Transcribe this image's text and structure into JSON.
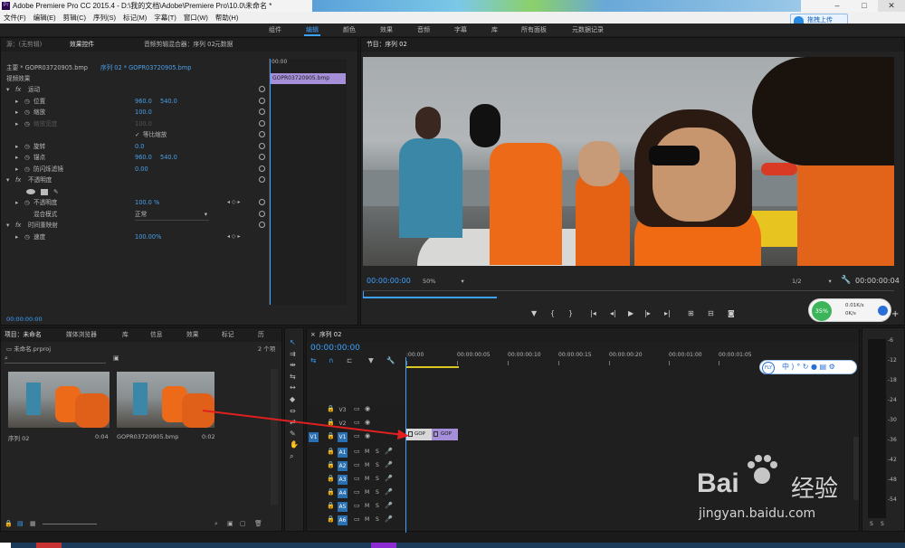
{
  "app": {
    "title": "Adobe Premiere Pro CC 2015.4 - D:\\我的文档\\Adobe\\Premiere Pro\\10.0\\未命名 *"
  },
  "menu": [
    "文件(F)",
    "编辑(E)",
    "剪辑(C)",
    "序列(S)",
    "标记(M)",
    "字幕(T)",
    "窗口(W)",
    "帮助(H)"
  ],
  "upload_label": "拖拽上传",
  "workspaces": [
    "组件",
    "编辑",
    "颜色",
    "效果",
    "音频",
    "字幕",
    "库",
    "所有面板",
    "元数据记录"
  ],
  "effect_controls": {
    "tabs": [
      "源：(无剪辑)",
      "效果控件",
      "音频剪辑混合器：序列 02",
      "元数据"
    ],
    "source": "主要 * GOPR03720905.bmp",
    "sequence": "序列 02 * GOPR03720905.bmp",
    "section": "视频效果",
    "ruler_time": "00:00",
    "clip_label": "GOPR03720905.bmp",
    "rows": [
      {
        "name": "运动",
        "type": "fx",
        "value1": "",
        "value2": ""
      },
      {
        "name": "位置",
        "type": "prop",
        "value1": "960.0",
        "value2": "540.0"
      },
      {
        "name": "缩放",
        "type": "prop",
        "value1": "100.0",
        "value2": ""
      },
      {
        "name": "缩放宽度",
        "type": "dim",
        "value1": "100.0",
        "value2": ""
      },
      {
        "name": "等比缩放",
        "type": "check",
        "value1": "",
        "value2": ""
      },
      {
        "name": "旋转",
        "type": "prop",
        "value1": "0.0",
        "value2": ""
      },
      {
        "name": "锚点",
        "type": "prop",
        "value1": "960.0",
        "value2": "540.0"
      },
      {
        "name": "防闪烁滤镜",
        "type": "prop",
        "value1": "0.00",
        "value2": ""
      },
      {
        "name": "不透明度",
        "type": "fx",
        "value1": "",
        "value2": ""
      },
      {
        "name": "",
        "type": "shapes",
        "value1": "",
        "value2": ""
      },
      {
        "name": "不透明度",
        "type": "prop",
        "value1": "100.0 %",
        "value2": ""
      },
      {
        "name": "混合模式",
        "type": "select",
        "value1": "正常",
        "value2": ""
      },
      {
        "name": "时间重映射",
        "type": "fx",
        "value1": "",
        "value2": ""
      },
      {
        "name": "速度",
        "type": "prop",
        "value1": "100.00%",
        "value2": ""
      }
    ],
    "footer_time": "00:00:00:00"
  },
  "program": {
    "title": "节目：序列 02",
    "timecode": "00:00:00:00",
    "zoom": "50%",
    "resolution": "1/2",
    "duration": "00:00:00:04"
  },
  "net_widget": {
    "percent": "35%",
    "upload": "0.01K/s",
    "download": "0K/s"
  },
  "project": {
    "tabs": [
      "项目：未命名",
      "媒体浏览器",
      "库",
      "信息",
      "效果",
      "标记",
      "历"
    ],
    "file": "未命名.prproj",
    "count": "2 个项",
    "items": [
      {
        "name": "序列 02",
        "duration": "0:04"
      },
      {
        "name": "GOPR03720905.bmp",
        "duration": "0:02"
      }
    ]
  },
  "timeline": {
    "tab": "序列 02",
    "timecode": "00:00:00:00",
    "ruler": [
      ":00:00",
      "00:00:00:05",
      "00:00:00:10",
      "00:00:00:15",
      "00:00:00:20",
      "00:00:01:00",
      "00:00:01:05"
    ],
    "video_tracks": [
      "V3",
      "V2",
      "V1"
    ],
    "audio_tracks": [
      "A1",
      "A2",
      "A3",
      "A4",
      "A5",
      "A6"
    ],
    "source_patch": "V1",
    "clips": [
      "GOP",
      "GOP"
    ]
  },
  "meter": {
    "labels": [
      "-6",
      "-12",
      "-18",
      "-24",
      "-30",
      "-36",
      "-42",
      "-48",
      "-54"
    ],
    "solo": [
      "S",
      "S"
    ]
  },
  "watermark": {
    "brand": "Bai",
    "brand2": "经验",
    "url": "jingyan.baidu.com"
  },
  "colors": {
    "accent": "#3da1ff",
    "clip_purple": "#a58fd8",
    "arrow": "#e02020"
  }
}
